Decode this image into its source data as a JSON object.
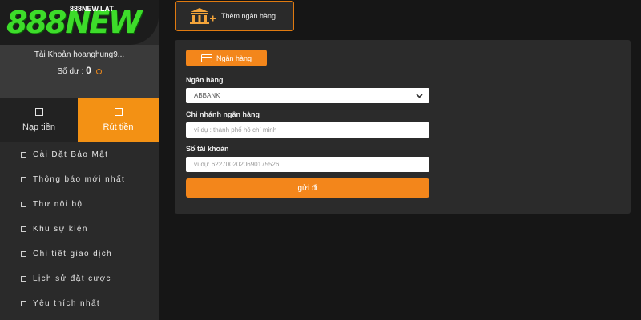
{
  "brand": {
    "logo": "888NEW",
    "domain": "888NEW.LAT",
    "accent_color": "#f3861b",
    "logo_color": "#3ddc2a"
  },
  "account": {
    "label": "Tài Khoản hoanghung9...",
    "balance_label": "Số dư :",
    "balance_value": "0"
  },
  "tabs": [
    {
      "label": "Nạp tiền",
      "active": false
    },
    {
      "label": "Rút tiền",
      "active": true
    }
  ],
  "menu": [
    {
      "label": "Cài Đặt Bảo Mật"
    },
    {
      "label": "Thông báo mới nhất"
    },
    {
      "label": "Thư nội bộ"
    },
    {
      "label": "Khu sự kiện"
    },
    {
      "label": "Chi tiết giao dịch"
    },
    {
      "label": "Lịch sử đặt cược"
    },
    {
      "label": "Yêu thích nhất"
    }
  ],
  "add_bank": {
    "label": "Thêm ngân hàng",
    "icon": "bank-plus-icon"
  },
  "form": {
    "tab_label": "Ngân hàng",
    "bank_label": "Ngân hàng",
    "bank_value": "ABBANK",
    "branch_label": "Chi nhánh ngân hàng",
    "branch_placeholder": "ví dụ : thành phố hồ chí minh",
    "account_label": "Số tài khoản",
    "account_placeholder": "ví dụ: 6227002020690175526",
    "submit_label": "gửi đi"
  }
}
